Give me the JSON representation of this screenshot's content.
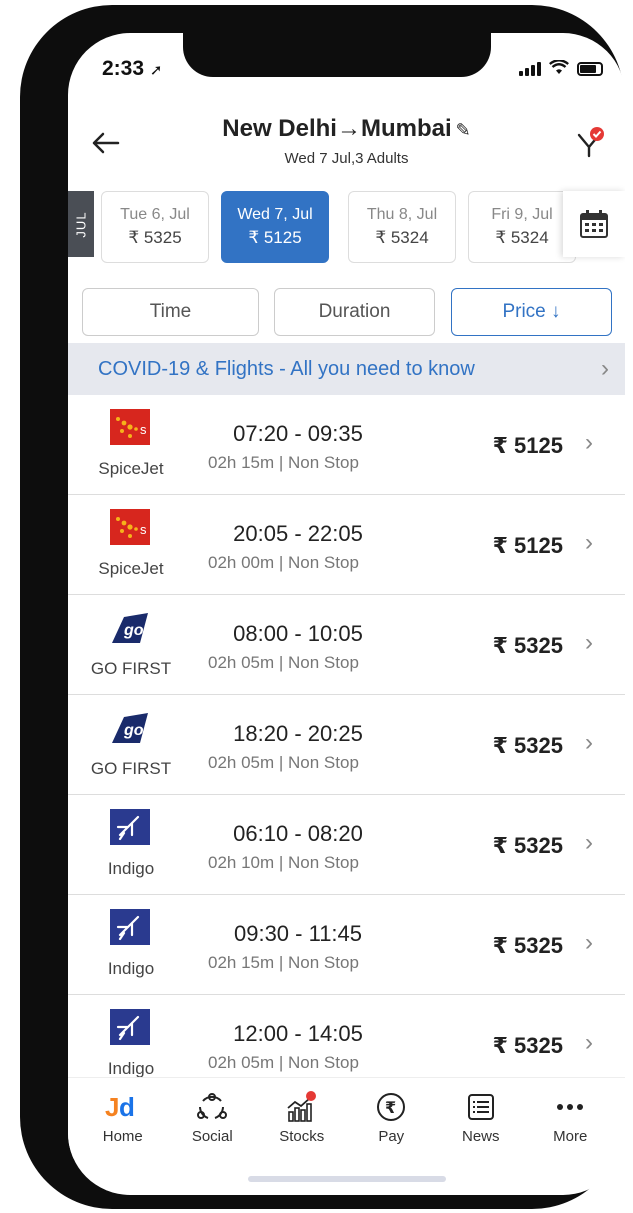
{
  "status_bar": {
    "time": "2:33"
  },
  "header": {
    "from": "New Delhi",
    "arrow": "→",
    "to": "Mumbai",
    "subtitle": "Wed 7 Jul,3 Adults"
  },
  "date_strip": {
    "month": "JUL",
    "dates": [
      {
        "label": "Tue 6, Jul",
        "price": "₹ 5325"
      },
      {
        "label": "Wed 7, Jul",
        "price": "₹ 5125",
        "selected": true
      },
      {
        "label": "Thu 8, Jul",
        "price": "₹ 5324"
      },
      {
        "label": "Fri 9, Jul",
        "price": "₹ 5324"
      }
    ]
  },
  "sort_tabs": [
    {
      "label": "Time"
    },
    {
      "label": "Duration"
    },
    {
      "label": "Price ↓",
      "active": true
    }
  ],
  "banner": {
    "text": "COVID-19 & Flights - All you need to know"
  },
  "flights": [
    {
      "airline": "SpiceJet",
      "logo": "spicejet",
      "times": "07:20 - 09:35",
      "meta": "02h 15m | Non Stop",
      "price": "₹ 5125"
    },
    {
      "airline": "SpiceJet",
      "logo": "spicejet",
      "times": "20:05 - 22:05",
      "meta": "02h 00m | Non Stop",
      "price": "₹ 5125"
    },
    {
      "airline": "GO FIRST",
      "logo": "gofirst",
      "times": "08:00 - 10:05",
      "meta": "02h 05m | Non Stop",
      "price": "₹ 5325"
    },
    {
      "airline": "GO FIRST",
      "logo": "gofirst",
      "times": "18:20 - 20:25",
      "meta": "02h 05m | Non Stop",
      "price": "₹ 5325"
    },
    {
      "airline": "Indigo",
      "logo": "indigo",
      "times": "06:10 - 08:20",
      "meta": "02h 10m | Non Stop",
      "price": "₹ 5325"
    },
    {
      "airline": "Indigo",
      "logo": "indigo",
      "times": "09:30 - 11:45",
      "meta": "02h 15m | Non Stop",
      "price": "₹ 5325"
    },
    {
      "airline": "Indigo",
      "logo": "indigo",
      "times": "12:00 - 14:05",
      "meta": "02h 05m | Non Stop",
      "price": "₹ 5325"
    }
  ],
  "bottom_nav": [
    {
      "label": "Home",
      "icon": "jd-logo"
    },
    {
      "label": "Social",
      "icon": "social-icon"
    },
    {
      "label": "Stocks",
      "icon": "stocks-icon"
    },
    {
      "label": "Pay",
      "icon": "rupee-icon"
    },
    {
      "label": "News",
      "icon": "news-icon"
    },
    {
      "label": "More",
      "icon": "more-icon"
    }
  ],
  "colors": {
    "accent": "#3273c4",
    "banner_bg": "#e6e8ee",
    "month_tab": "#4a4e55",
    "jd_orange": "#f58220",
    "jd_blue": "#1a73e8",
    "badge_red": "#e53935"
  }
}
